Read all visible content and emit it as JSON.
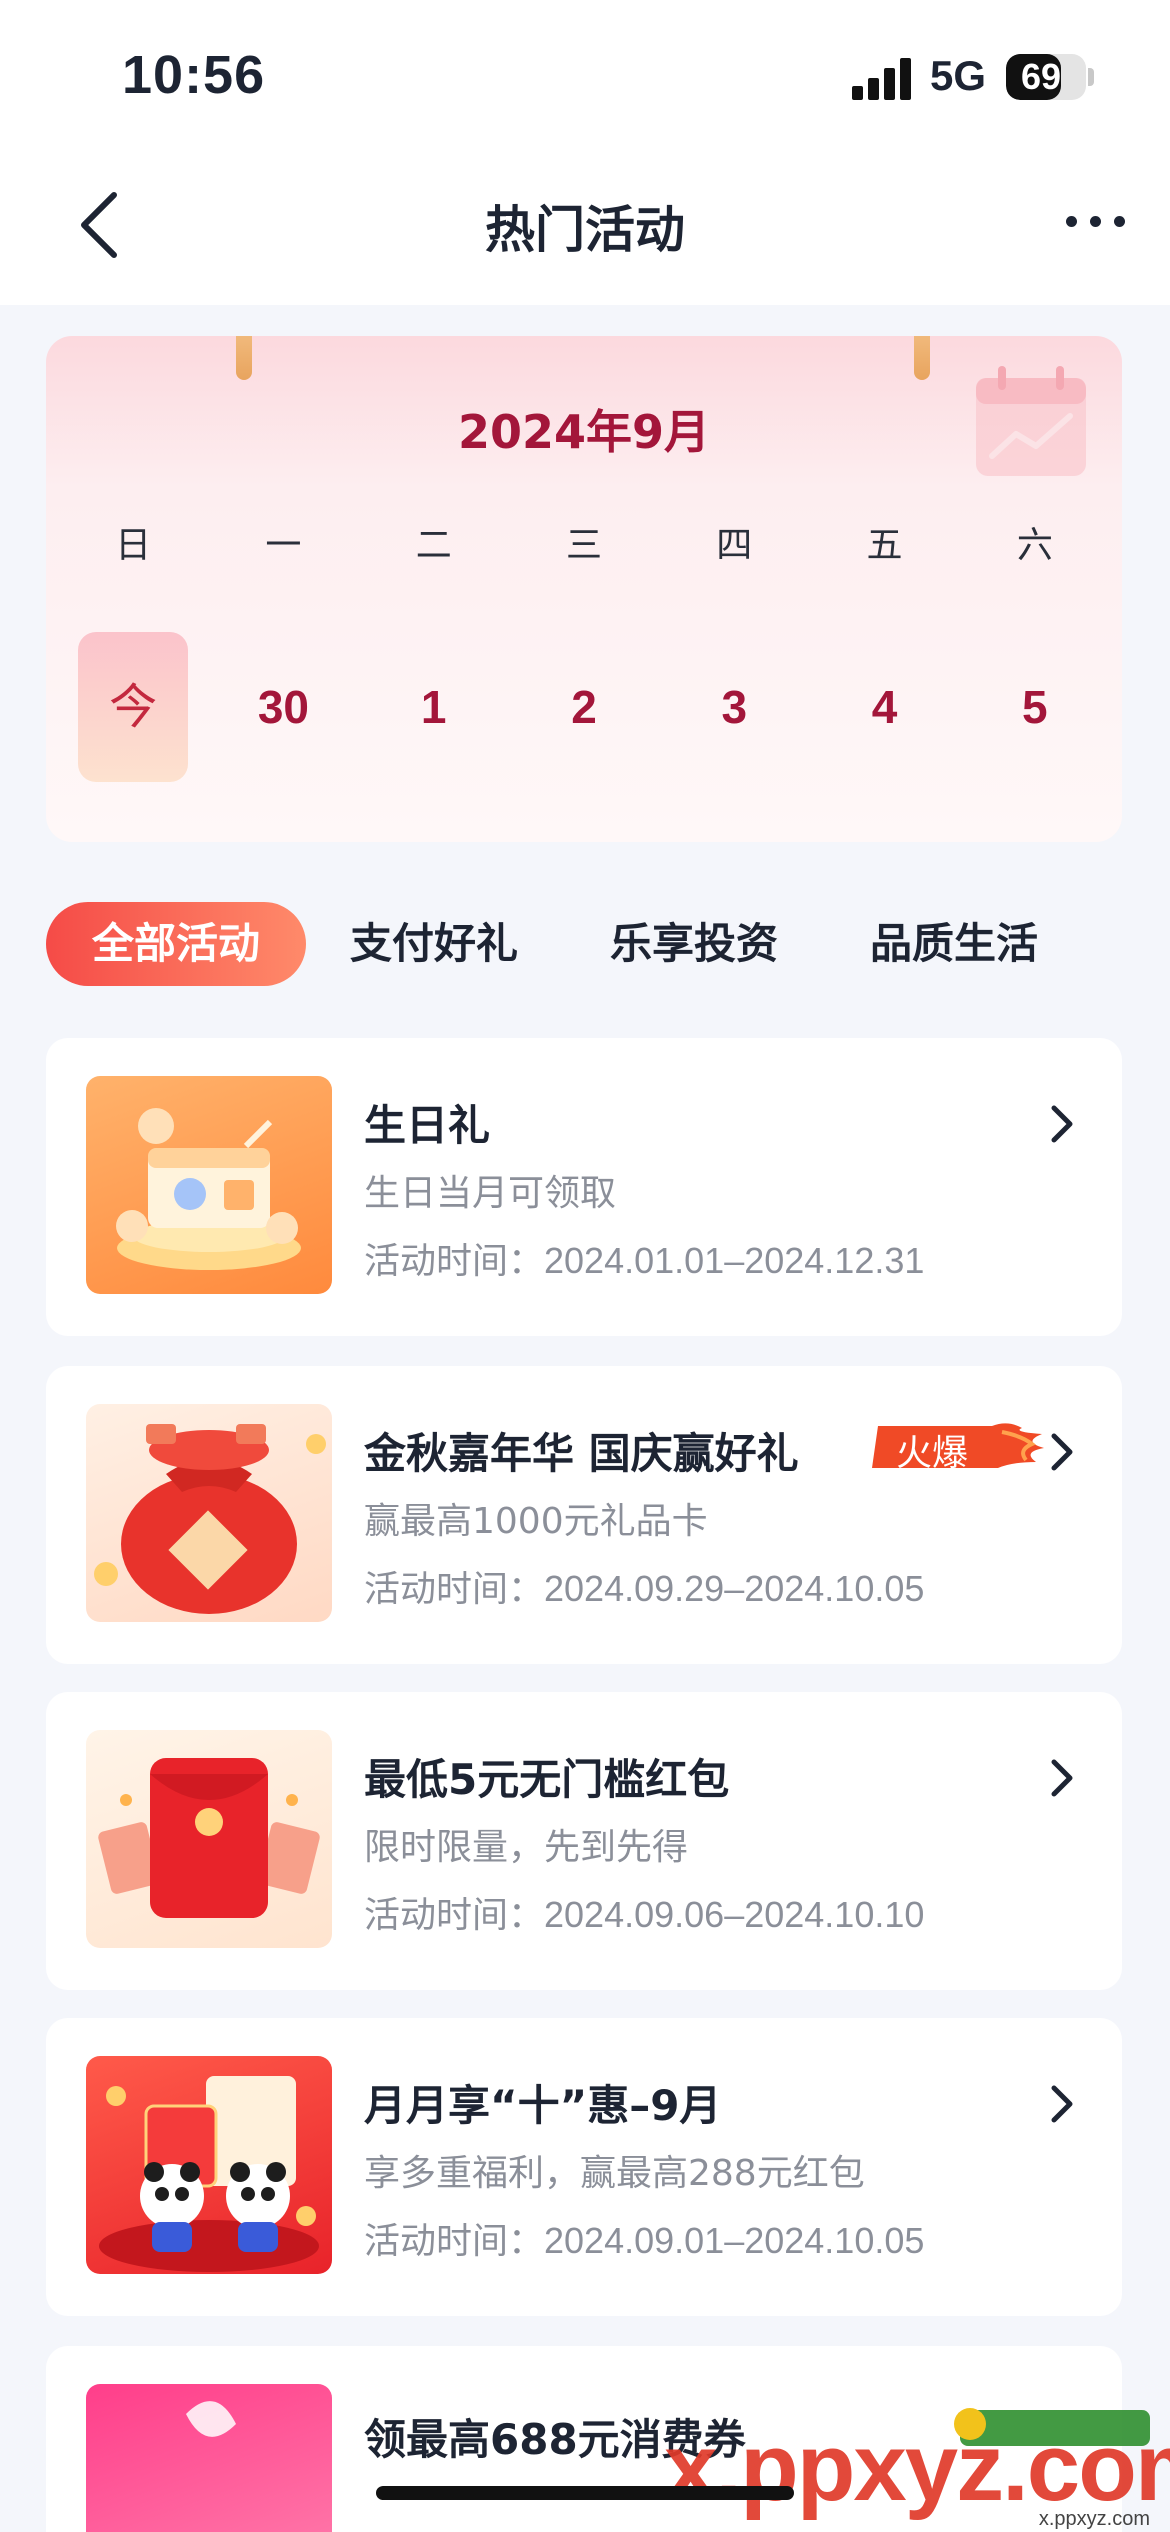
{
  "status_bar": {
    "time": "10:56",
    "network": "5G",
    "battery": "69",
    "battery_level": 0.69
  },
  "nav": {
    "title": "热门活动"
  },
  "calendar": {
    "month": "2024年9月",
    "weekdays": [
      "日",
      "一",
      "二",
      "三",
      "四",
      "五",
      "六"
    ],
    "days": [
      "今",
      "30",
      "1",
      "2",
      "3",
      "4",
      "5"
    ]
  },
  "tabs": [
    "全部活动",
    "支付好礼",
    "乐享投资",
    "品质生活"
  ],
  "activities": [
    {
      "title": "生日礼",
      "desc": "生日当月可领取",
      "time_label": "活动时间：",
      "time": "2024.01.01–2024.12.31",
      "thumb_icon": "gift-box-illustration"
    },
    {
      "title": "金秋嘉年华 国庆赢好礼",
      "badge": "火爆",
      "desc": "赢最高1000元礼品卡",
      "time_label": "活动时间：",
      "time": "2024.09.29–2024.10.05",
      "thumb_icon": "lucky-bag-illustration"
    },
    {
      "title": "最低5元无门槛红包",
      "desc": "限时限量，先到先得",
      "time_label": "活动时间：",
      "time": "2024.09.06–2024.10.10",
      "thumb_icon": "red-envelope-illustration"
    },
    {
      "title": "月月享“十”惠–9月",
      "desc": "享多重福利，赢最高288元红包",
      "time_label": "活动时间：",
      "time": "2024.09.01–2024.10.05",
      "thumb_icon": "panda-illustration"
    },
    {
      "title": "领最高688元消费券",
      "thumb_icon": "pink-banner-illustration"
    }
  ],
  "watermark": {
    "text": "x.ppxyz.com",
    "url": "x.ppxyz.com"
  },
  "colors": {
    "accent": "#f54b47",
    "calendar_text": "#a3163a",
    "muted_text": "#8b8f99"
  }
}
